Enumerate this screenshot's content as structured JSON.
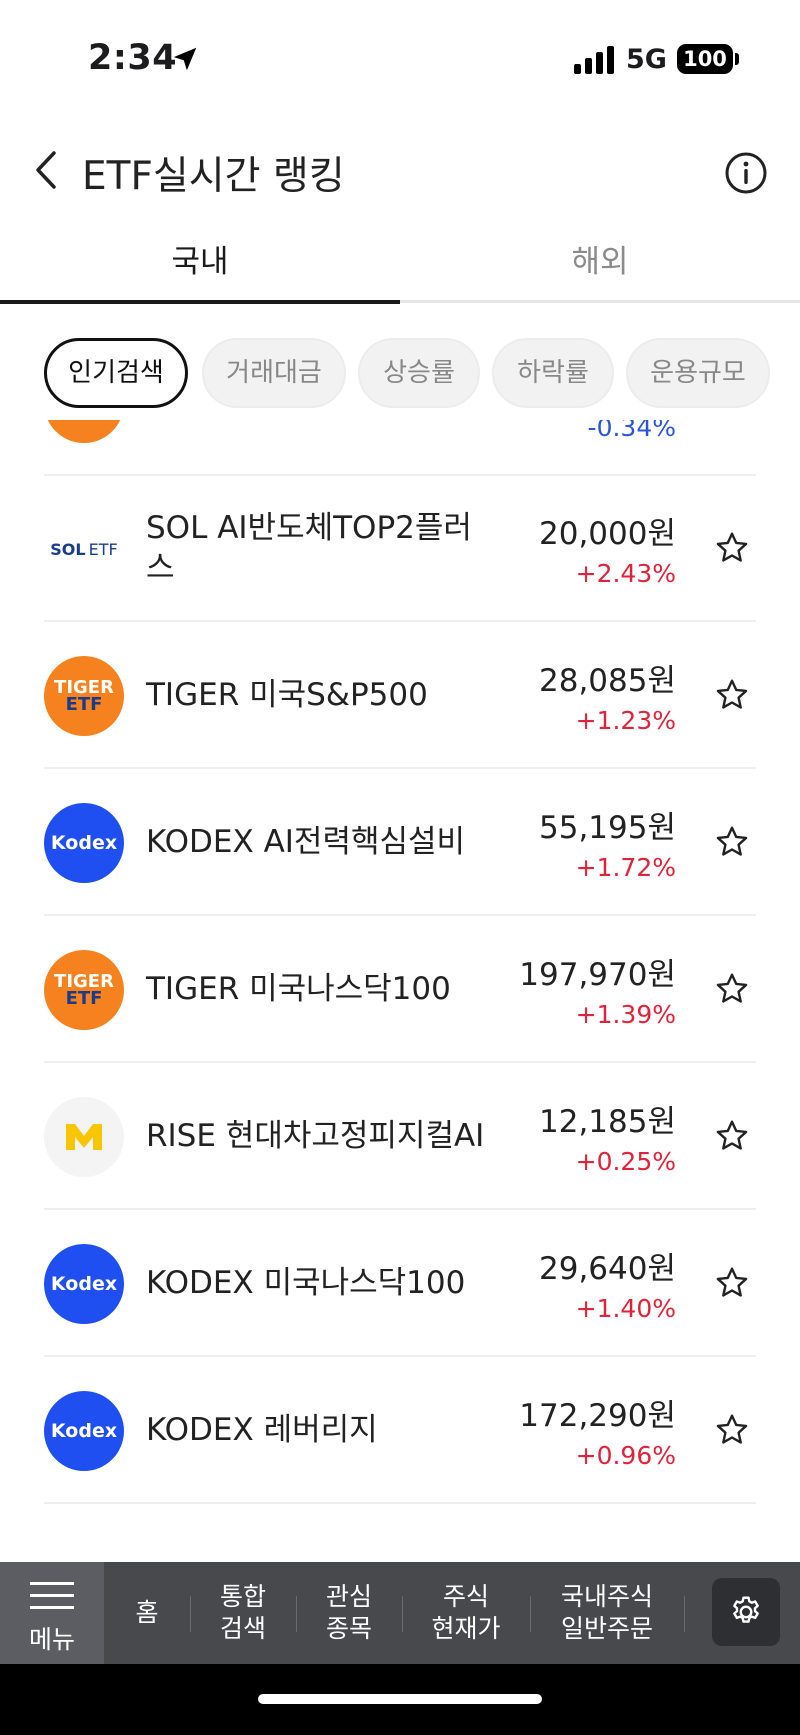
{
  "status_bar": {
    "time": "2:34",
    "network": "5G",
    "battery": "100"
  },
  "header": {
    "title": "ETF실시간 랭킹"
  },
  "tabs": [
    {
      "label": "국내"
    },
    {
      "label": "해외"
    }
  ],
  "chips": [
    {
      "label": "인기검색"
    },
    {
      "label": "거래대금"
    },
    {
      "label": "상승률"
    },
    {
      "label": "하락률"
    },
    {
      "label": "운용규모"
    }
  ],
  "partial_row": {
    "change": "-0.34%"
  },
  "items": [
    {
      "logo_line1": "SOL",
      "logo_line2": "ETF",
      "name": "SOL AI반도체TOP2플러스",
      "price": "20,000원",
      "change": "+2.43%"
    },
    {
      "logo_line1": "TIGER",
      "logo_line2": "ETF",
      "name": "TIGER 미국S&P500",
      "price": "28,085원",
      "change": "+1.23%"
    },
    {
      "logo_line1": "Kodex",
      "name": "KODEX AI전력핵심설비",
      "price": "55,195원",
      "change": "+1.72%"
    },
    {
      "logo_line1": "TIGER",
      "logo_line2": "ETF",
      "name": "TIGER 미국나스닥100",
      "price": "197,970원",
      "change": "+1.39%"
    },
    {
      "name": "RISE 현대차고정피지컬AI",
      "price": "12,185원",
      "change": "+0.25%"
    },
    {
      "logo_line1": "Kodex",
      "name": "KODEX 미국나스닥100",
      "price": "29,640원",
      "change": "+1.40%"
    },
    {
      "logo_line1": "Kodex",
      "name": "KODEX 레버리지",
      "price": "172,290원",
      "change": "+0.96%"
    }
  ],
  "bottom_nav": {
    "menu": "메뉴",
    "items": [
      {
        "label": "홈"
      },
      {
        "label": "통합\n검색"
      },
      {
        "label": "관심\n종목"
      },
      {
        "label": "주식\n현재가"
      },
      {
        "label": "국내주식\n일반주문"
      }
    ]
  },
  "colors": {
    "up": "#e0223a",
    "down": "#2b55d8",
    "tiger": "#f5821f",
    "kodex": "#1f4ff0",
    "nav_bg": "#48494d"
  },
  "icons": {
    "back": "chevron-left-icon",
    "info": "info-circle-icon",
    "favorite": "star-outline-icon",
    "settings": "gear-icon",
    "menu": "hamburger-icon"
  }
}
